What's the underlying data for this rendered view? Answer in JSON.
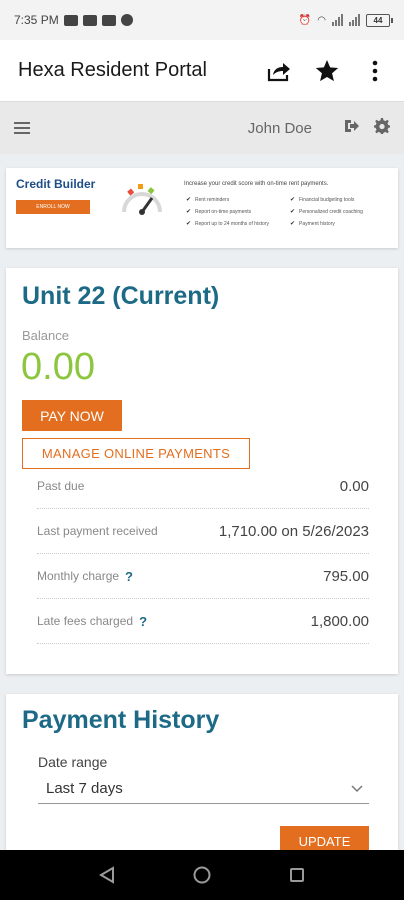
{
  "status_bar": {
    "time": "7:35 PM",
    "battery_level": "44"
  },
  "app_bar": {
    "title": "Hexa Resident Portal",
    "icons": [
      "share-icon",
      "star-icon",
      "more-vert-icon"
    ]
  },
  "user_bar": {
    "user_name": "John Doe",
    "icons": [
      "menu-icon",
      "logout-icon",
      "gear-icon"
    ]
  },
  "credit_builder": {
    "title": "Credit Builder",
    "enroll_label": "ENROLL NOW",
    "headline": "Increase your credit score with on-time rent payments.",
    "features": [
      "Rent reminders",
      "Financial budgeting tools",
      "Report on-time payments",
      "Personalized credit coaching",
      "Report up to 24 months of history",
      "Payment history"
    ]
  },
  "unit": {
    "title": "Unit 22 (Current)",
    "balance_label": "Balance",
    "balance_value": "0.00",
    "pay_now_label": "PAY NOW",
    "manage_label": "MANAGE ONLINE PAYMENTS",
    "rows": [
      {
        "label": "Past due",
        "value": "0.00",
        "help": ""
      },
      {
        "label": "Last payment received",
        "value": "1,710.00 on 5/26/2023",
        "help": ""
      },
      {
        "label": "Monthly charge",
        "value": "795.00",
        "help": "?"
      },
      {
        "label": "Late fees charged",
        "value": "1,800.00",
        "help": "?"
      }
    ]
  },
  "payment_history": {
    "title": "Payment History",
    "date_range_label": "Date range",
    "date_range_value": "Last 7 days",
    "update_label": "UPDATE"
  },
  "colors": {
    "accent_orange": "#e36e1f",
    "heading_blue": "#1d6a87",
    "balance_green": "#8cc63f"
  }
}
